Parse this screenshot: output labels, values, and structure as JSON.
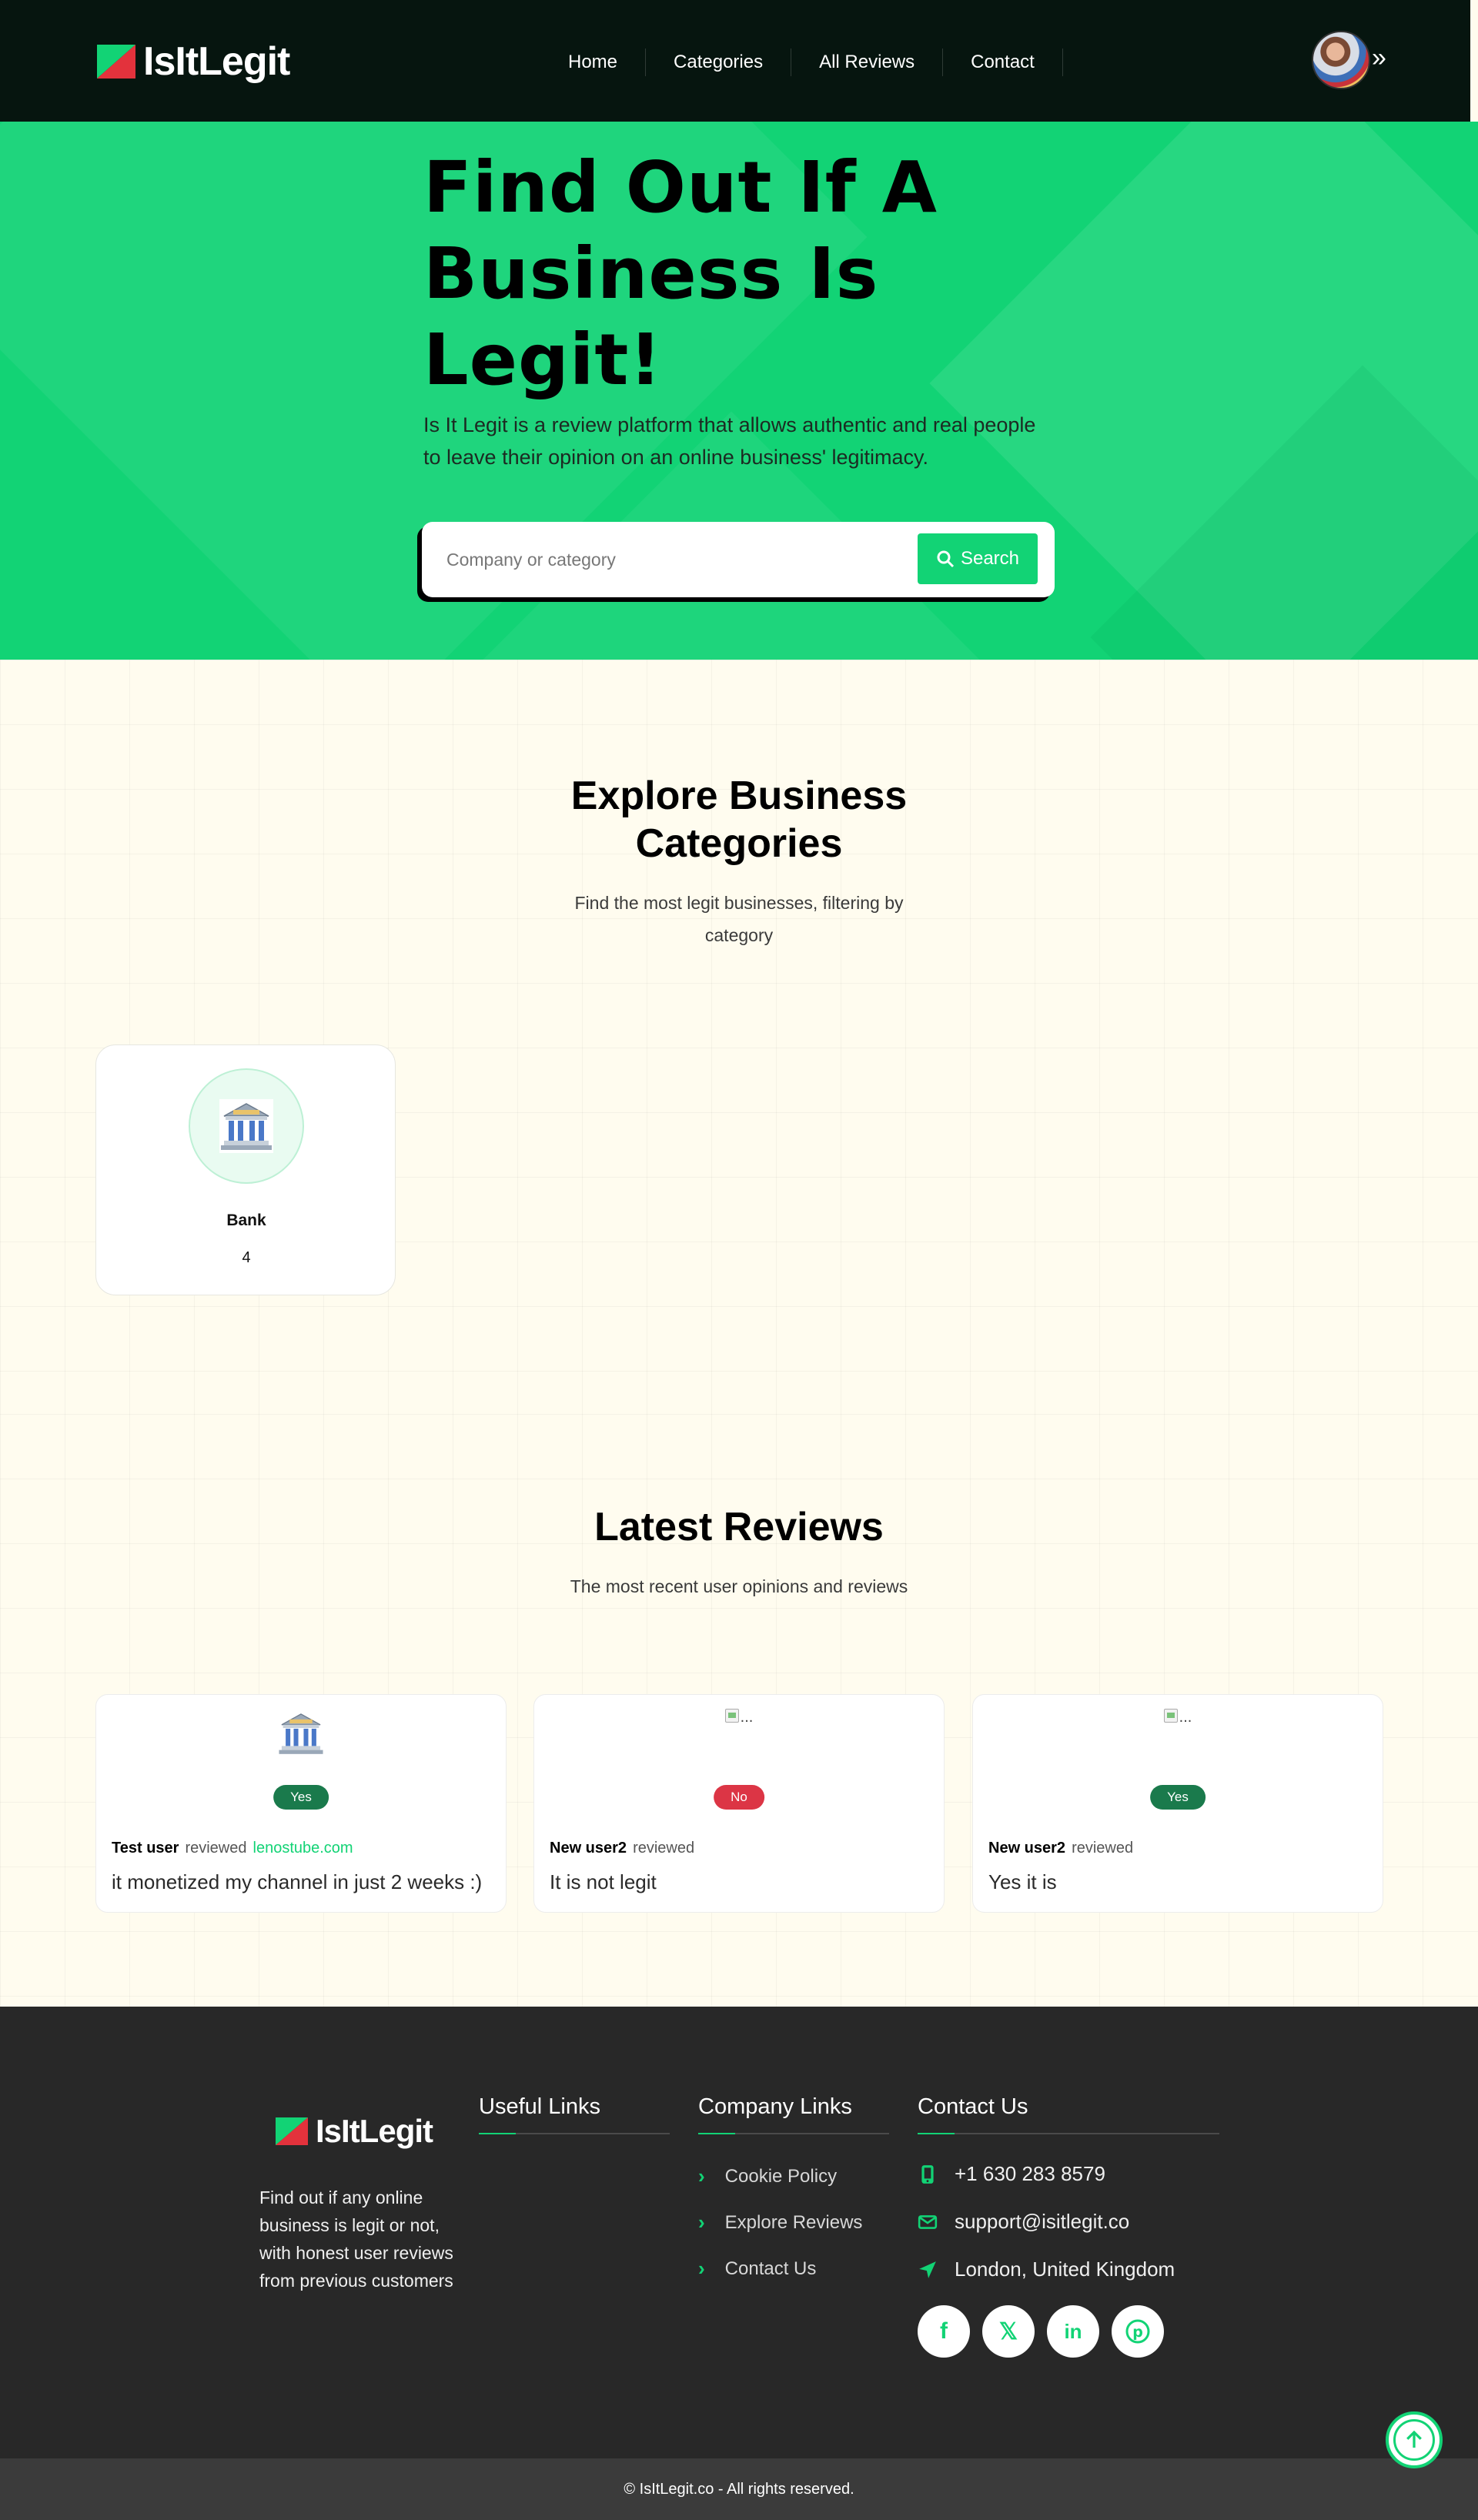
{
  "brand": {
    "name": "IsItLegit"
  },
  "nav": {
    "items": [
      "Home",
      "Categories",
      "All Reviews",
      "Contact"
    ]
  },
  "hero": {
    "title": "Find Out If A Business Is Legit!",
    "subtitle": "Is It Legit is a review platform that allows authentic and real people to leave their opinion on an online business' legitimacy.",
    "search_placeholder": "Company or category",
    "search_button": "Search"
  },
  "categories": {
    "title": "Explore Business Categories",
    "subtitle": "Find the most legit businesses, filtering by category",
    "items": [
      {
        "name": "Bank",
        "count": "4",
        "icon": "bank-icon"
      }
    ]
  },
  "reviews": {
    "title": "Latest Reviews",
    "subtitle": "The most recent user opinions and reviews",
    "items": [
      {
        "image": "bank-icon",
        "image_alt": "",
        "verdict": "Yes",
        "user": "Test user",
        "action": "reviewed",
        "company": "lenostube.com",
        "text": "it monetized my channel in just 2 weeks :)"
      },
      {
        "image": "broken-image-icon",
        "image_alt": "...",
        "verdict": "No",
        "user": "New user2",
        "action": "reviewed",
        "company": "",
        "text": "It is not legit"
      },
      {
        "image": "broken-image-icon",
        "image_alt": "...",
        "verdict": "Yes",
        "user": "New user2",
        "action": "reviewed",
        "company": "",
        "text": "Yes it is"
      }
    ]
  },
  "footer": {
    "description": "Find out if any online business is legit or not, with honest user reviews from previous customers",
    "useful_links_title": "Useful Links",
    "company_links_title": "Company Links",
    "company_links": [
      "Cookie Policy",
      "Explore Reviews",
      "Contact Us"
    ],
    "contact_title": "Contact Us",
    "phone": "+1 630 283 8579",
    "email": "support@isitlegit.co",
    "location": "London, United Kingdom",
    "socials": [
      "facebook-icon",
      "x-icon",
      "linkedin-icon",
      "pinterest-icon"
    ],
    "copyright": "© IsItLegit.co - All rights reserved."
  },
  "colors": {
    "accent": "#12d375",
    "nav_bg": "#06150f",
    "footer_bg": "#282828",
    "yes": "#1a7a4c",
    "no": "#dc3545"
  }
}
